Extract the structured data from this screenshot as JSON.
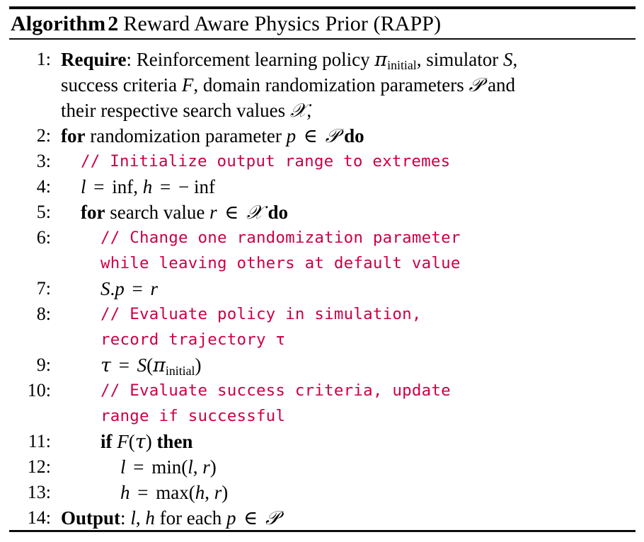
{
  "document": {
    "type": "algorithm-pseudocode-float",
    "title": {
      "keyword": "Algorithm",
      "number": "2",
      "caption": "Reward Aware Physics Prior (RAPP)"
    },
    "colors": {
      "text": "#000000",
      "rule": "#0d0d0d",
      "comment": "#cc0044",
      "background": "#ffffff"
    },
    "symbols": {
      "pi": "π",
      "tau": "τ",
      "in": "∈",
      "minus": "−",
      "cal_P": "𝒫",
      "cal_R": "𝓇",
      "cal_S": "S",
      "cal_F": "F"
    },
    "lines": [
      {
        "number": "1:",
        "indent": 0,
        "kind": "statement",
        "keyword": "Require",
        "text": "Require: Reinforcement learning policy πinitial, simulator S, success criteria F, domain randomization parameters 𝒫 and their respective search values 𝓇,",
        "rows": [
          "Require: Reinforcement learning policy πinitial, simulator S,",
          "success criteria F, domain randomization parameters 𝒫 and",
          "their respective search values 𝓇,"
        ]
      },
      {
        "number": "2:",
        "indent": 0,
        "kind": "for",
        "text": "for randomization parameter p ∈ 𝒫 do"
      },
      {
        "number": "3:",
        "indent": 1,
        "kind": "comment",
        "text": "// Initialize output range to extremes"
      },
      {
        "number": "4:",
        "indent": 1,
        "kind": "math",
        "text": "l = inf, h = − inf"
      },
      {
        "number": "5:",
        "indent": 1,
        "kind": "for",
        "text": "for search value r ∈ 𝓇 do"
      },
      {
        "number": "6:",
        "indent": 2,
        "kind": "comment",
        "text": "// Change one randomization parameter while leaving others at default value",
        "rows": [
          "// Change one randomization parameter",
          "while leaving others at default value"
        ]
      },
      {
        "number": "7:",
        "indent": 2,
        "kind": "math",
        "text": "S.p = r"
      },
      {
        "number": "8:",
        "indent": 2,
        "kind": "comment",
        "text": "// Evaluate policy in simulation, record trajectory τ",
        "rows": [
          "// Evaluate policy in simulation,",
          "record trajectory τ"
        ]
      },
      {
        "number": "9:",
        "indent": 2,
        "kind": "math",
        "text": "τ = S(πinitial)"
      },
      {
        "number": "10:",
        "indent": 2,
        "kind": "comment",
        "text": "// Evaluate success criteria, update range if successful",
        "rows": [
          "// Evaluate success criteria, update",
          "range if successful"
        ]
      },
      {
        "number": "11:",
        "indent": 2,
        "kind": "if",
        "text": "if F(τ) then"
      },
      {
        "number": "12:",
        "indent": 3,
        "kind": "math",
        "text": "l = min(l, r)"
      },
      {
        "number": "13:",
        "indent": 3,
        "kind": "math",
        "text": "h = max(h, r)"
      },
      {
        "number": "14:",
        "indent": 0,
        "kind": "statement",
        "keyword": "Output",
        "text": "Output: l, h for each p ∈ 𝒫"
      }
    ]
  }
}
